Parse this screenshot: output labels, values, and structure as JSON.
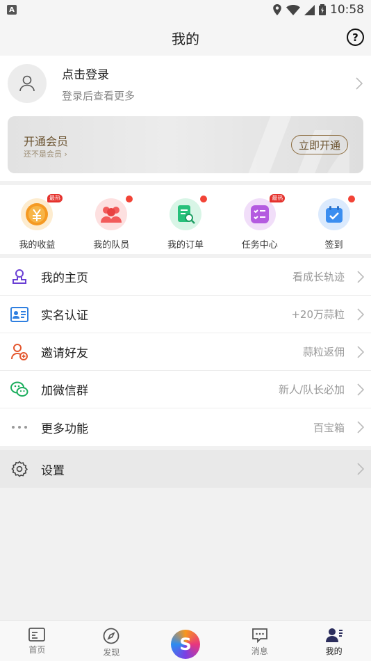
{
  "status_bar": {
    "time": "10:58",
    "notification_icon": "A"
  },
  "header": {
    "title": "我的",
    "help_icon": "?"
  },
  "profile": {
    "login_label": "点击登录",
    "sub_label": "登录后查看更多"
  },
  "vip": {
    "title": "开通会员",
    "status": "还不是会员",
    "button": "立即开通"
  },
  "quick_actions": [
    {
      "label": "我的收益",
      "badge": "最热",
      "icon": "yuan-coin-icon",
      "color": "#f59a23"
    },
    {
      "label": "我的队员",
      "badge": "dot",
      "icon": "team-icon",
      "color": "#f25b5b"
    },
    {
      "label": "我的订单",
      "badge": "dot",
      "icon": "order-search-icon",
      "color": "#27c07a"
    },
    {
      "label": "任务中心",
      "badge": "最热",
      "icon": "task-list-icon",
      "color": "#b45be0"
    },
    {
      "label": "签到",
      "badge": "dot",
      "icon": "calendar-check-icon",
      "color": "#3b8ef0"
    }
  ],
  "menu": [
    {
      "label": "我的主页",
      "value": "看成长轨迹",
      "icon": "user-stamp-icon",
      "color": "#6a3fd4"
    },
    {
      "label": "实名认证",
      "value": "+20万蒜粒",
      "icon": "id-card-icon",
      "color": "#2f7fe0"
    },
    {
      "label": "邀请好友",
      "value": "蒜粒返佣",
      "icon": "invite-user-icon",
      "color": "#e4572e"
    },
    {
      "label": "加微信群",
      "value": "新人/队长必加",
      "icon": "wechat-icon",
      "color": "#1aad5c"
    },
    {
      "label": "更多功能",
      "value": "百宝箱",
      "icon": "more-dots-icon",
      "color": "#999999"
    }
  ],
  "settings": {
    "label": "设置"
  },
  "tabs": [
    {
      "label": "首页",
      "icon": "home-news-icon"
    },
    {
      "label": "发现",
      "icon": "compass-icon"
    },
    {
      "label": "",
      "icon": "app-logo-icon"
    },
    {
      "label": "消息",
      "icon": "message-icon"
    },
    {
      "label": "我的",
      "icon": "profile-icon",
      "active": true
    }
  ]
}
